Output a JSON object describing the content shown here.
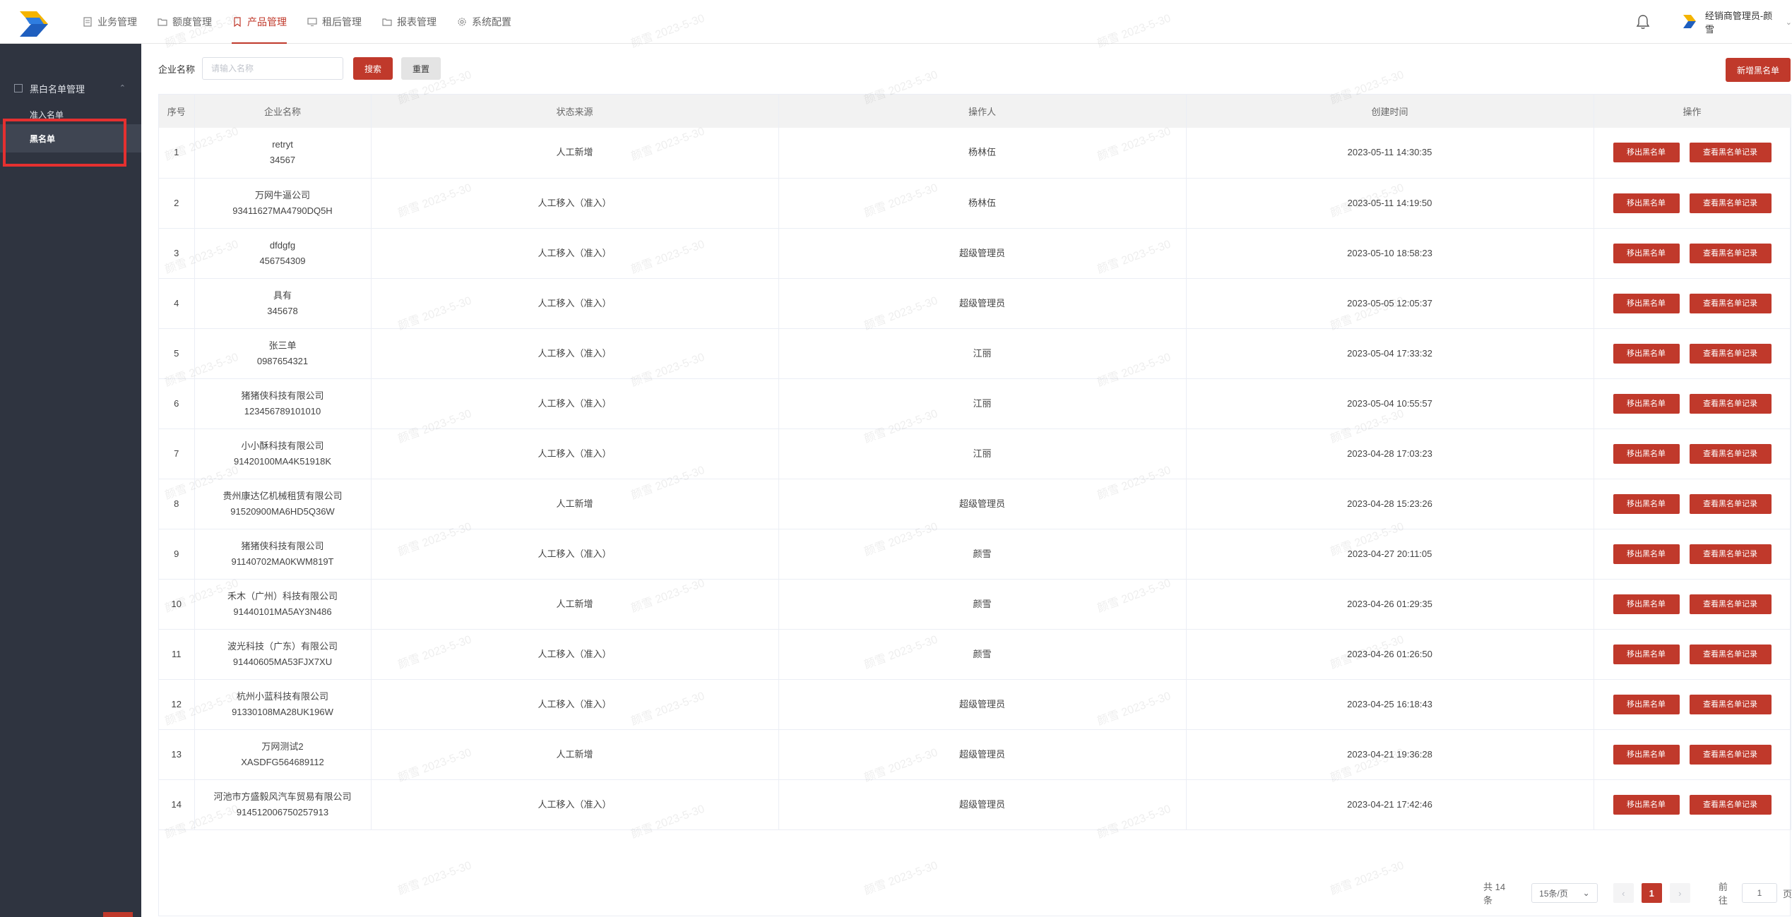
{
  "colors": {
    "accent": "#c0392b",
    "sidebar_bg": "#2f3440",
    "header_bg": "#f2f2f2"
  },
  "topnav": {
    "items": [
      {
        "label": "业务管理",
        "icon": "document-icon"
      },
      {
        "label": "额度管理",
        "icon": "folder-icon"
      },
      {
        "label": "产品管理",
        "icon": "bookmark-icon",
        "active": true
      },
      {
        "label": "租后管理",
        "icon": "monitor-icon"
      },
      {
        "label": "报表管理",
        "icon": "folder-icon"
      },
      {
        "label": "系统配置",
        "icon": "gear-icon"
      }
    ],
    "user_label": "经销商管理员-颜雪"
  },
  "sidebar": {
    "group_label": "黑白名单管理",
    "items": [
      {
        "label": "准入名单"
      },
      {
        "label": "黑名单",
        "active": true
      }
    ]
  },
  "search": {
    "label": "企业名称",
    "placeholder": "请输入名称",
    "search_button": "搜索",
    "reset_button": "重置",
    "add_button": "新增黑名单"
  },
  "table": {
    "headers": [
      "序号",
      "企业名称",
      "状态来源",
      "操作人",
      "创建时间",
      "操作"
    ],
    "remove_label": "移出黑名单",
    "view_label": "查看黑名单记录",
    "rows": [
      {
        "no": "1",
        "name": "retryt",
        "code": "34567",
        "source": "人工新增",
        "operator": "杨林伍",
        "time": "2023-05-11 14:30:35"
      },
      {
        "no": "2",
        "name": "万网牛逼公司",
        "code": "93411627MA4790DQ5H",
        "source": "人工移入（准入）",
        "operator": "杨林伍",
        "time": "2023-05-11 14:19:50"
      },
      {
        "no": "3",
        "name": "dfdgfg",
        "code": "456754309",
        "source": "人工移入（准入）",
        "operator": "超级管理员",
        "time": "2023-05-10 18:58:23"
      },
      {
        "no": "4",
        "name": "具有",
        "code": "345678",
        "source": "人工移入（准入）",
        "operator": "超级管理员",
        "time": "2023-05-05 12:05:37"
      },
      {
        "no": "5",
        "name": "张三单",
        "code": "0987654321",
        "source": "人工移入（准入）",
        "operator": "江丽",
        "time": "2023-05-04 17:33:32"
      },
      {
        "no": "6",
        "name": "猪猪侠科技有限公司",
        "code": "123456789101010",
        "source": "人工移入（准入）",
        "operator": "江丽",
        "time": "2023-05-04 10:55:57"
      },
      {
        "no": "7",
        "name": "小小酥科技有限公司",
        "code": "91420100MA4K51918K",
        "source": "人工移入（准入）",
        "operator": "江丽",
        "time": "2023-04-28 17:03:23"
      },
      {
        "no": "8",
        "name": "贵州康达亿机械租赁有限公司",
        "code": "91520900MA6HD5Q36W",
        "source": "人工新增",
        "operator": "超级管理员",
        "time": "2023-04-28 15:23:26"
      },
      {
        "no": "9",
        "name": "猪猪侠科技有限公司",
        "code": "91140702MA0KWM819T",
        "source": "人工移入（准入）",
        "operator": "颜雪",
        "time": "2023-04-27 20:11:05"
      },
      {
        "no": "10",
        "name": "禾木（广州）科技有限公司",
        "code": "91440101MA5AY3N486",
        "source": "人工新增",
        "operator": "颜雪",
        "time": "2023-04-26 01:29:35"
      },
      {
        "no": "11",
        "name": "波光科技（广东）有限公司",
        "code": "91440605MA53FJX7XU",
        "source": "人工移入（准入）",
        "operator": "颜雪",
        "time": "2023-04-26 01:26:50"
      },
      {
        "no": "12",
        "name": "杭州小蓝科技有限公司",
        "code": "91330108MA28UK196W",
        "source": "人工移入（准入）",
        "operator": "超级管理员",
        "time": "2023-04-25 16:18:43"
      },
      {
        "no": "13",
        "name": "万网测试2",
        "code": "XASDFG564689112",
        "source": "人工新增",
        "operator": "超级管理员",
        "time": "2023-04-21 19:36:28"
      },
      {
        "no": "14",
        "name": "河池市方盛毅风汽车贸易有限公司",
        "code": "914512006750257913",
        "source": "人工移入（准入）",
        "operator": "超级管理员",
        "time": "2023-04-21 17:42:46"
      }
    ]
  },
  "pagination": {
    "total_text": "共 14 条",
    "page_size": "15条/页",
    "current_page": "1",
    "goto_label": "前往",
    "goto_value": "1",
    "page_suffix": "页"
  },
  "watermark_text": "颜雪 2023-5-30"
}
